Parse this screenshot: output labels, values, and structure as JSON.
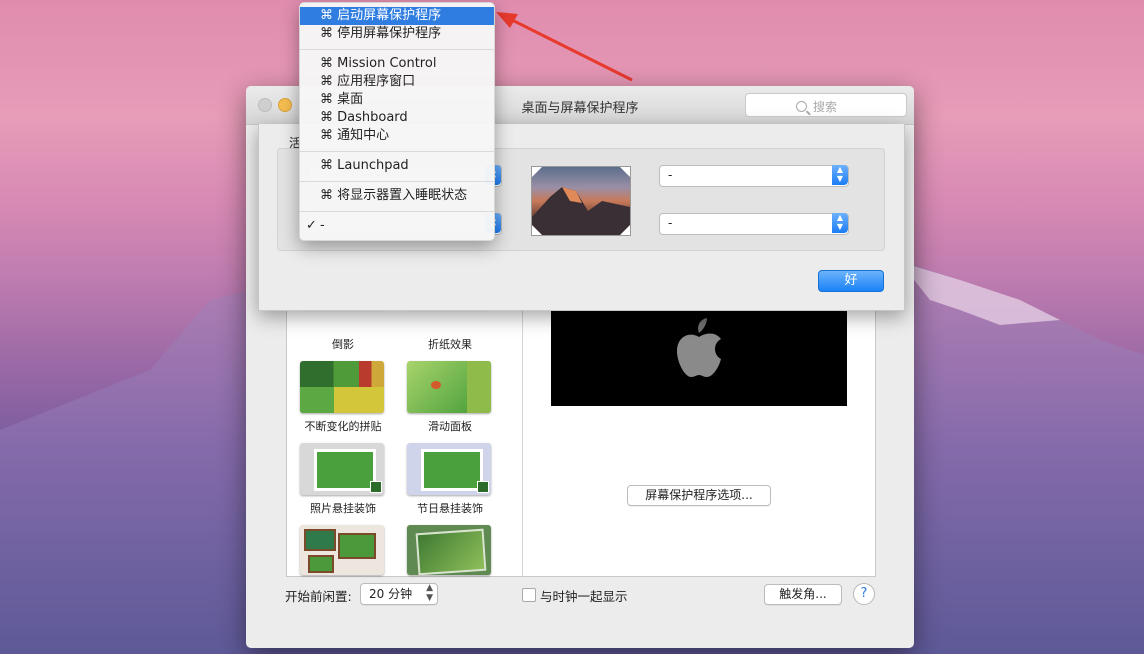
{
  "window": {
    "title": "桌面与屏幕保护程序",
    "search_placeholder": "搜索"
  },
  "sheet": {
    "partial_label": "活",
    "popup_values": [
      "-",
      "-"
    ],
    "ok_label": "好"
  },
  "menu": {
    "items": [
      {
        "label": "⌘ 启动屏幕保护程序",
        "selected": true
      },
      {
        "label": "⌘ 停用屏幕保护程序"
      },
      {
        "label": "⌘ Mission Control"
      },
      {
        "label": "⌘ 应用程序窗口"
      },
      {
        "label": "⌘ 桌面"
      },
      {
        "label": "⌘ Dashboard"
      },
      {
        "label": "⌘ 通知中心"
      },
      {
        "label": "⌘ Launchpad"
      },
      {
        "label": "⌘ 将显示器置入睡眠状态"
      },
      {
        "label": "-",
        "checked": true
      }
    ],
    "check_mark": "✓"
  },
  "screensavers": {
    "items": [
      {
        "label": "倒影"
      },
      {
        "label": "折纸效果"
      },
      {
        "label": "不断变化的拼贴"
      },
      {
        "label": "滑动面板"
      },
      {
        "label": "照片悬挂装饰"
      },
      {
        "label": "节日悬挂装饰"
      }
    ]
  },
  "options_button": "屏幕保护程序选项...",
  "bottom": {
    "idle_label": "开始前闲置:",
    "idle_value": "20 分钟",
    "clock_label": "与时钟一起显示",
    "hot_corners_label": "触发角...",
    "help_label": "?"
  },
  "colors": {
    "accent": "#2f7de1",
    "arrow": "#e8392d"
  }
}
